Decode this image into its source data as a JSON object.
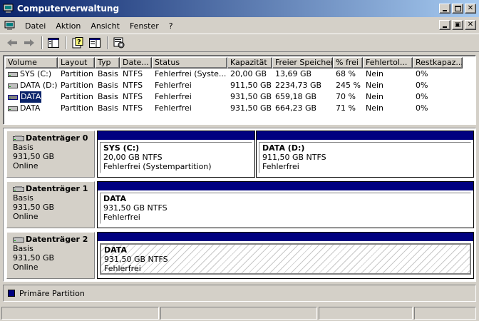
{
  "window": {
    "title": "Computerverwaltung"
  },
  "menu": {
    "items": [
      "Datei",
      "Aktion",
      "Ansicht",
      "Fenster",
      "?"
    ]
  },
  "columns": [
    "Volume",
    "Layout",
    "Typ",
    "Date...",
    "Status",
    "Kapazität",
    "Freier Speicher",
    "% frei",
    "Fehlertol...",
    "Restkapaz..."
  ],
  "volumes": [
    {
      "volume": "SYS (C:)",
      "layout": "Partition",
      "typ": "Basis",
      "fs": "NTFS",
      "status": "Fehlerfrei (Syste...",
      "kap": "20,00 GB",
      "frei": "13,69 GB",
      "pct": "68 %",
      "ft": "Nein",
      "rest": "0%"
    },
    {
      "volume": "DATA (D:)",
      "layout": "Partition",
      "typ": "Basis",
      "fs": "NTFS",
      "status": "Fehlerfrei",
      "kap": "911,50 GB",
      "frei": "2234,73 GB",
      "pct": "245 %",
      "ft": "Nein",
      "rest": "0%"
    },
    {
      "volume": "DATA",
      "layout": "Partition",
      "typ": "Basis",
      "fs": "NTFS",
      "status": "Fehlerfrei",
      "kap": "931,50 GB",
      "frei": "659,18 GB",
      "pct": "70 %",
      "ft": "Nein",
      "rest": "0%"
    },
    {
      "volume": "DATA",
      "layout": "Partition",
      "typ": "Basis",
      "fs": "NTFS",
      "status": "Fehlerfrei",
      "kap": "931,50 GB",
      "frei": "664,23 GB",
      "pct": "71 %",
      "ft": "Nein",
      "rest": "0%"
    }
  ],
  "disks": [
    {
      "name": "Datenträger 0",
      "type": "Basis",
      "size": "931,50 GB",
      "state": "Online",
      "partitions": [
        {
          "name": "SYS  (C:)",
          "size": "20,00 GB NTFS",
          "status": "Fehlerfrei (Systempartition)"
        },
        {
          "name": "DATA  (D:)",
          "size": "911,50 GB NTFS",
          "status": "Fehlerfrei"
        }
      ]
    },
    {
      "name": "Datenträger 1",
      "type": "Basis",
      "size": "931,50 GB",
      "state": "Online",
      "partitions": [
        {
          "name": "DATA",
          "size": "931,50 GB NTFS",
          "status": "Fehlerfrei"
        }
      ]
    },
    {
      "name": "Datenträger 2",
      "type": "Basis",
      "size": "931,50 GB",
      "state": "Online",
      "partitions": [
        {
          "name": "DATA",
          "size": "931,50 GB NTFS",
          "status": "Fehlerfrei"
        }
      ]
    }
  ],
  "legend": {
    "label": "Primäre Partition",
    "color": "#000080"
  },
  "colors": {
    "partition_bar": "#000080",
    "title_start": "#0a246a",
    "title_end": "#a6caf0",
    "selection": "#0a246a"
  },
  "icons": {
    "app": "computer-management-icon",
    "back": "back-arrow-icon",
    "forward": "forward-arrow-icon",
    "console_tree": "console-tree-icon",
    "help": "help-icon",
    "properties": "properties-icon",
    "settings": "settings-icon",
    "drive": "drive-icon",
    "disk": "disk-icon"
  }
}
